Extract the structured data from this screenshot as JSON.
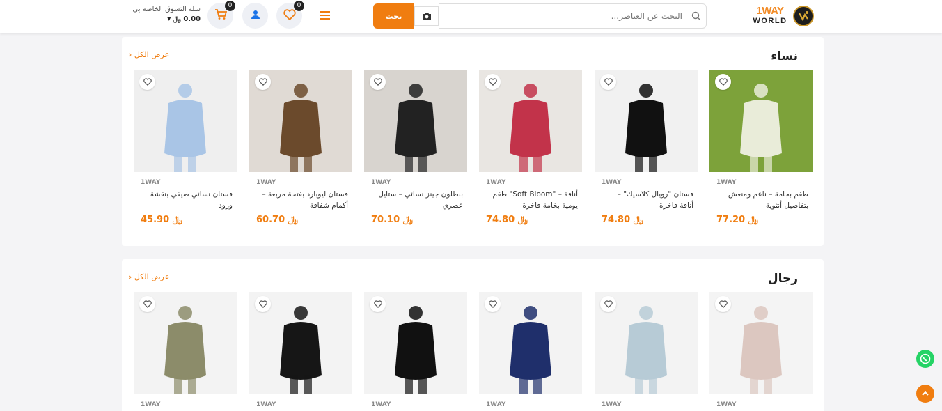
{
  "header": {
    "logo_top": "1WAY",
    "logo_bottom": "WORLD",
    "search_placeholder": "البحث عن العناصر...",
    "search_button": "بحث",
    "wishlist_count": "0",
    "cart_count": "0",
    "cart_label": "سلة التسوق الخاصة بي",
    "cart_total": "0.00",
    "currency_symbol": "﷼"
  },
  "women": {
    "title": "نساء",
    "view_all": "عرض الكل",
    "products": [
      {
        "brand": "1WAY",
        "name": "طقم بجامة – ناعم ومنعش بتفاصيل أنثوية",
        "price": "77.20",
        "icon": "green-pajama-set-image"
      },
      {
        "brand": "1WAY",
        "name": "فستان \"رويال كلاسيك\" – أناقة فاخرة",
        "price": "74.80",
        "icon": "black-dress-image"
      },
      {
        "brand": "1WAY",
        "name": "أناقة – \"Soft Bloom\" طقم يومية بخامة فاخرة",
        "price": "74.80",
        "icon": "floral-skirt-set-image"
      },
      {
        "brand": "1WAY",
        "name": "بنطلون جينز نسائي – ستايل عصري",
        "price": "70.10",
        "icon": "jeans-outfit-image"
      },
      {
        "brand": "1WAY",
        "name": "فستان ليوبارد بفتحة مربعة – أكمام شفافة",
        "price": "60.70",
        "icon": "leopard-dress-image"
      },
      {
        "brand": "1WAY",
        "name": "فستان نسائي صيفي بنقشة ورود",
        "price": "45.90",
        "icon": "floral-summer-dress-image"
      }
    ]
  },
  "men": {
    "title": "رجال",
    "view_all": "عرض الكل",
    "products": [
      {
        "brand": "1WAY",
        "icon": "backpacks-image"
      },
      {
        "brand": "1WAY",
        "icon": "light-blue-shirt-image"
      },
      {
        "brand": "1WAY",
        "icon": "navy-tshirt-image"
      },
      {
        "brand": "1WAY",
        "icon": "black-fish-tshirt-image"
      },
      {
        "brand": "1WAY",
        "icon": "black-graphic-tshirt-image"
      },
      {
        "brand": "1WAY",
        "icon": "olive-polo-image"
      }
    ]
  },
  "colors": {
    "accent": "#f07d10",
    "whatsapp": "#25d366"
  }
}
